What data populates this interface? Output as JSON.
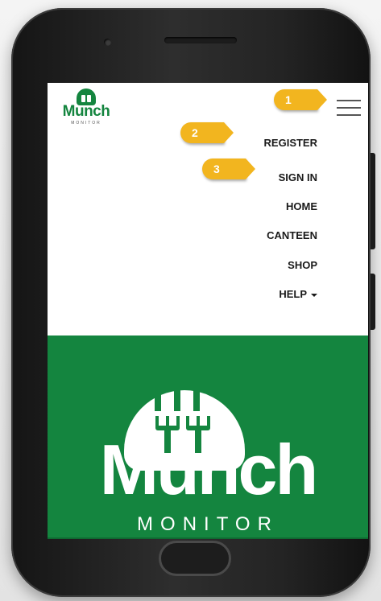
{
  "brand": {
    "name": "Munch",
    "tagline": "MONITOR"
  },
  "nav": {
    "items": [
      {
        "label": "REGISTER"
      },
      {
        "label": "SIGN IN"
      },
      {
        "label": "HOME"
      },
      {
        "label": "CANTEEN"
      },
      {
        "label": "SHOP"
      },
      {
        "label": "HELP"
      }
    ]
  },
  "callouts": [
    "1",
    "2",
    "3"
  ],
  "hero": {
    "title": "Munch",
    "subtitle": "MONITOR"
  },
  "colors": {
    "brand_green": "#14853f",
    "callout": "#f2b51f",
    "nav_text": "#1a1a1a"
  },
  "icons": {
    "menu": "hamburger-menu-icon",
    "help_dropdown": "caret-down-icon",
    "logo": "fork-dome-logo"
  }
}
